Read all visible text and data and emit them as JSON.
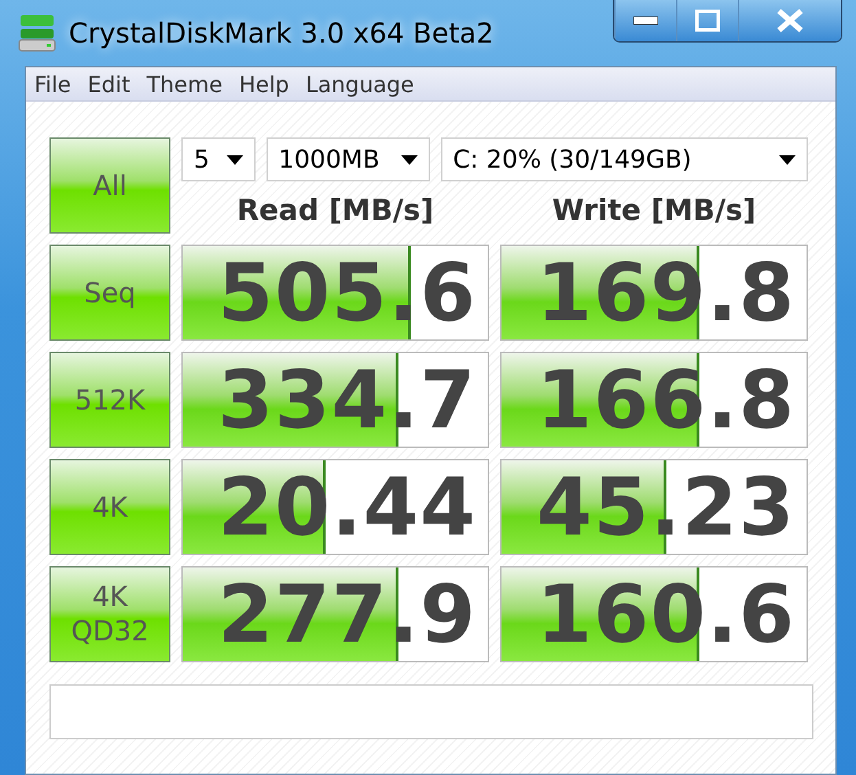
{
  "window": {
    "title": "CrystalDiskMark 3.0 x64 Beta2"
  },
  "menu": [
    "File",
    "Edit",
    "Theme",
    "Help",
    "Language"
  ],
  "all_button": "All",
  "selectors": [
    {
      "value": "5"
    },
    {
      "value": "1000MB"
    },
    {
      "value": "C: 20% (30/149GB)"
    }
  ],
  "columns": [
    "Read [MB/s]",
    "Write [MB/s]"
  ],
  "rows": [
    {
      "label": "Seq",
      "results": [
        {
          "value": "505.6",
          "level": 0.74
        },
        {
          "value": "169.8",
          "level": 0.64
        }
      ]
    },
    {
      "label": "512K",
      "results": [
        {
          "value": "334.7",
          "level": 0.7
        },
        {
          "value": "166.8",
          "level": 0.64
        }
      ]
    },
    {
      "label": "4K",
      "results": [
        {
          "value": "20.44",
          "level": 0.46
        },
        {
          "value": "45.23",
          "level": 0.53
        }
      ]
    },
    {
      "label": "4K\nQD32",
      "results": [
        {
          "value": "277.9",
          "level": 0.7
        },
        {
          "value": "160.6",
          "level": 0.64
        }
      ]
    }
  ]
}
